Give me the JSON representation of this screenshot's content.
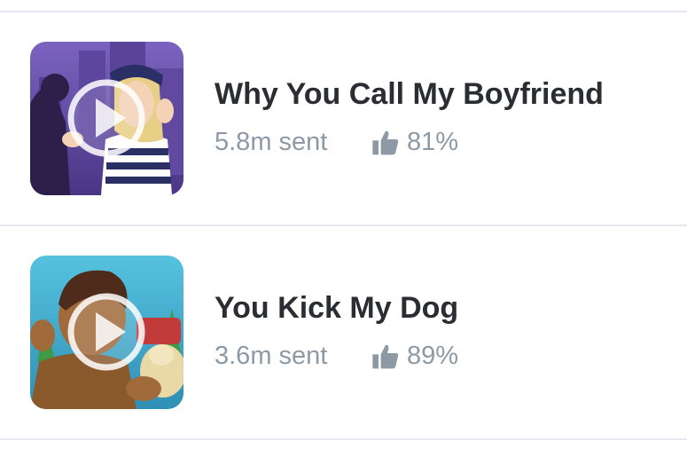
{
  "items": [
    {
      "title": "Why You Call My Boyfriend",
      "sent": "5.8m sent",
      "likes": "81%",
      "thumb_icon": "play-circle-icon",
      "thumb_bg": "#6b4fa6"
    },
    {
      "title": "You Kick My Dog",
      "sent": "3.6m sent",
      "likes": "89%",
      "thumb_icon": "play-circle-icon",
      "thumb_bg": "#3aa7c6"
    }
  ],
  "colors": {
    "title": "#2a2d31",
    "meta": "#8d9aa6",
    "divider": "#e3e8ee"
  },
  "icons": {
    "likes": "thumbs-up-icon"
  }
}
